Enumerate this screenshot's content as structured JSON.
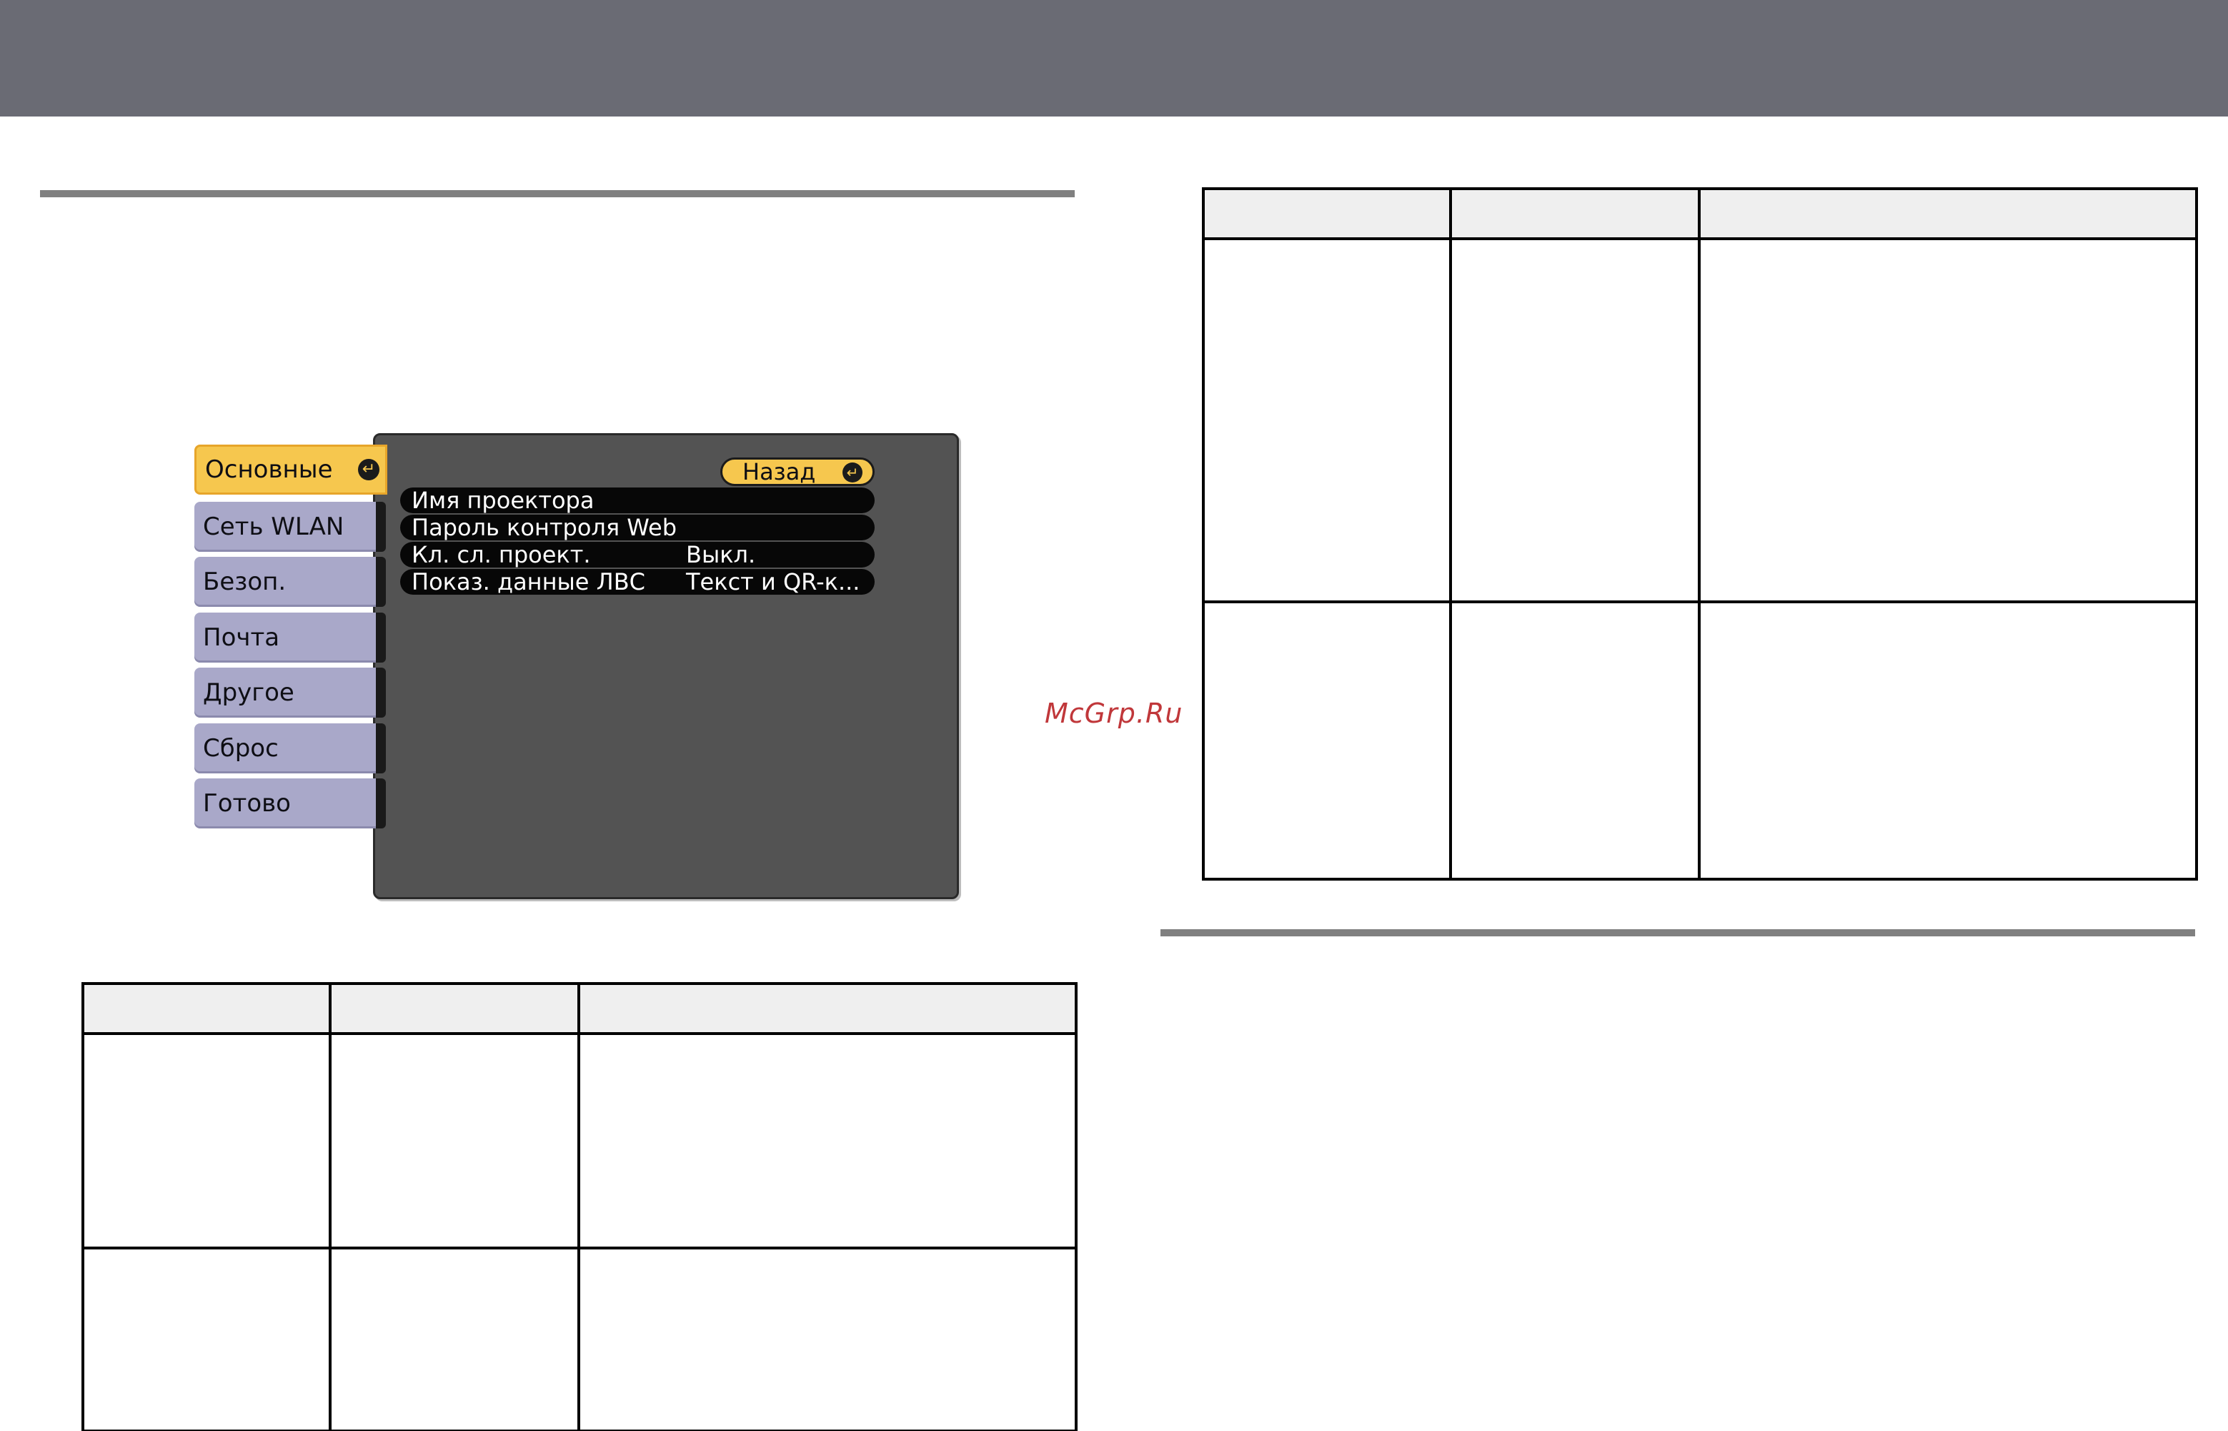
{
  "watermark": "McGrp.Ru",
  "colors": {
    "top_band": "#6a6b74",
    "menu_panel": "#535353",
    "tab_inactive": "#a9a8c9",
    "tab_active": "#f6c74e",
    "watermark": "#c0373a"
  },
  "menu": {
    "tabs": [
      {
        "label": "Основные",
        "active": true,
        "icon": "enter-icon"
      },
      {
        "label": "Сеть WLAN",
        "active": false
      },
      {
        "label": "Безоп.",
        "active": false
      },
      {
        "label": "Почта",
        "active": false
      },
      {
        "label": "Другое",
        "active": false
      },
      {
        "label": "Сброс",
        "active": false
      },
      {
        "label": "Готово",
        "active": false
      }
    ],
    "back_label": "Назад",
    "items": [
      {
        "label": "Имя проектора",
        "value": ""
      },
      {
        "label": "Пароль контроля Web",
        "value": ""
      },
      {
        "label": "Кл. сл. проект.",
        "value": "Выкл."
      },
      {
        "label": "Показ. данные ЛВС",
        "value": "Текст и QR-к..."
      }
    ]
  },
  "tables": {
    "left": {
      "headers": [
        "",
        "",
        ""
      ],
      "rows": [
        [
          "",
          "",
          ""
        ],
        [
          "",
          "",
          ""
        ]
      ]
    },
    "right": {
      "headers": [
        "",
        "",
        ""
      ],
      "rows": [
        [
          "",
          "",
          ""
        ],
        [
          "",
          "",
          ""
        ]
      ]
    }
  }
}
